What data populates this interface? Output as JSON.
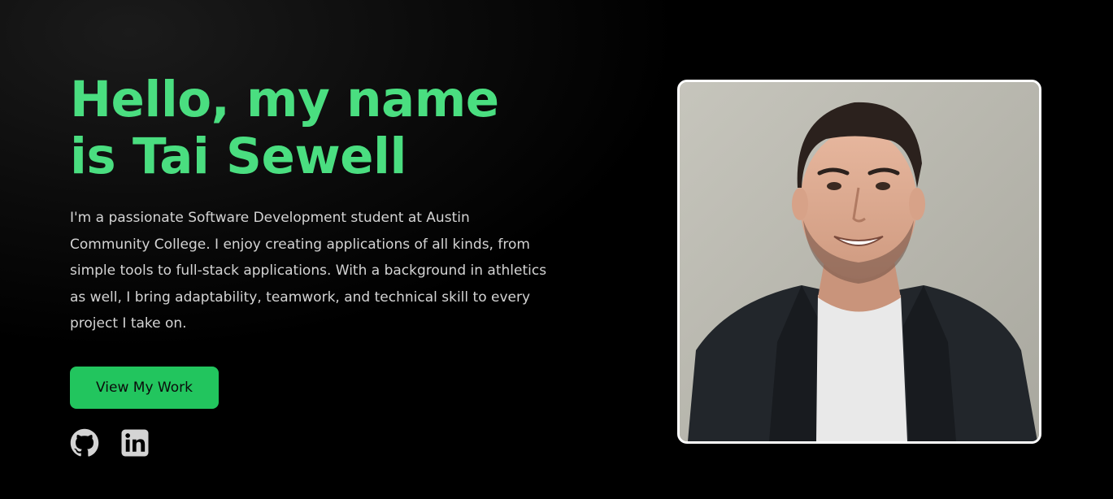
{
  "hero": {
    "headline_line1": "Hello, my name",
    "headline_line2": "is Tai Sewell",
    "bio": "I'm a passionate Software Development student at Austin Community College. I enjoy creating applications of all kinds, from simple tools to full-stack applications. With a background in athletics as well, I bring adaptability, teamwork, and technical skill to every project I take on.",
    "cta_label": "View My Work",
    "socials": [
      {
        "icon": "github-icon"
      },
      {
        "icon": "linkedin-icon"
      }
    ],
    "photo_alt": "Portrait of Tai Sewell"
  },
  "colors": {
    "accent": "#4ade80",
    "button": "#22c55e",
    "text": "#d4d4d4",
    "background": "#000000"
  }
}
